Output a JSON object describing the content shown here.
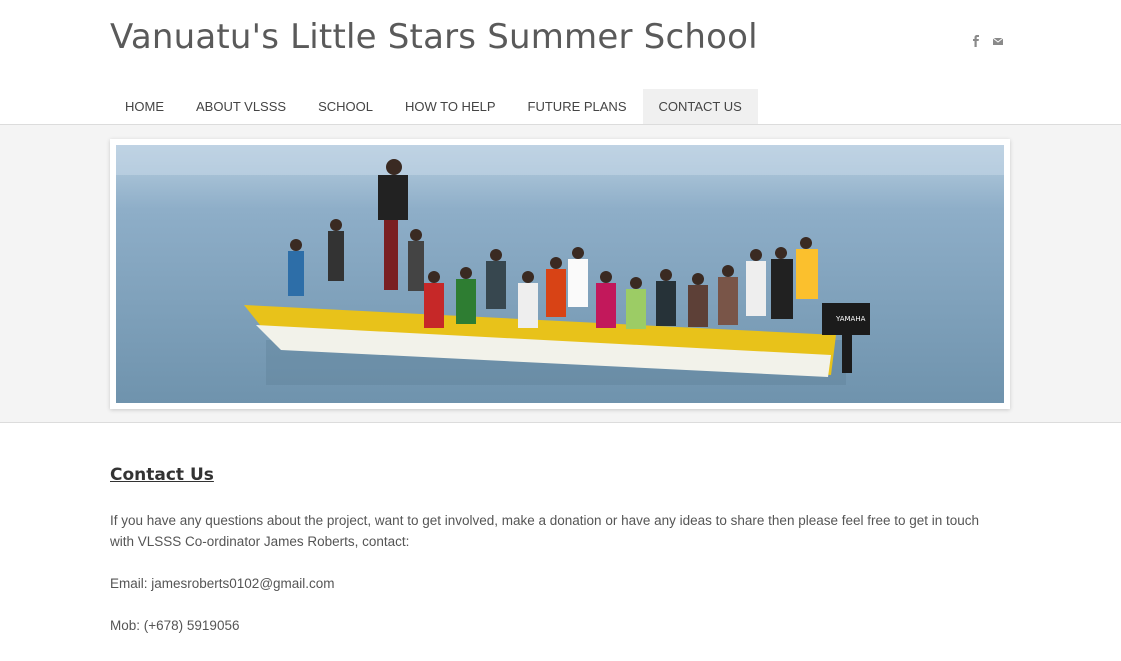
{
  "site": {
    "title": "Vanuatu's Little Stars Summer School"
  },
  "social": [
    {
      "name": "facebook-icon"
    },
    {
      "name": "mail-icon"
    }
  ],
  "nav": {
    "items": [
      {
        "label": "HOME"
      },
      {
        "label": "ABOUT VLSSS"
      },
      {
        "label": "SCHOOL"
      },
      {
        "label": "HOW TO HELP"
      },
      {
        "label": "FUTURE PLANS"
      },
      {
        "label": "CONTACT US"
      }
    ],
    "active": "CONTACT US"
  },
  "banner": {
    "image": "boat-with-children-photo",
    "motor_brand": "YAMAHA"
  },
  "content": {
    "heading": "Contact Us",
    "intro": "If you have any questions about the project, want to get involved, make a donation or have any ideas to share then please feel free to get in touch with VLSSS Co-ordinator James Roberts, contact:",
    "email": "Email: jamesroberts0102@gmail.com",
    "mobile": "Mob: (+678) 5919056"
  },
  "colors": {
    "title": "#5a5a5a",
    "nav_active_bg": "#f0f0f0",
    "band_bg": "#f4f4f4",
    "boat_yellow": "#e8c21a",
    "sea": "#8fb0c6"
  }
}
